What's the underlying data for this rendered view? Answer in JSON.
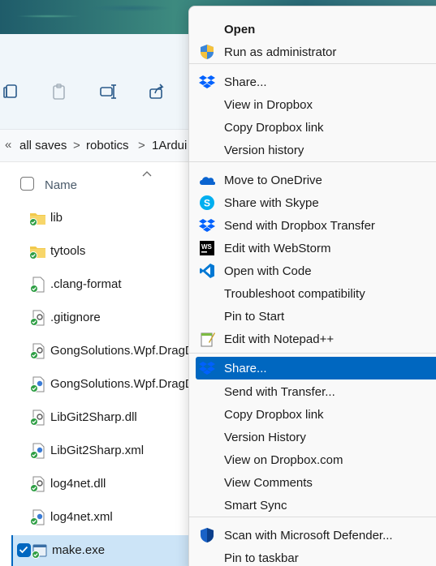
{
  "explorer": {
    "breadcrumb": {
      "chevron": "«",
      "items": [
        "all saves",
        "robotics",
        "1Ardui"
      ],
      "separators": [
        ">",
        ">"
      ]
    },
    "column_name": "Name",
    "files": [
      {
        "name": "lib",
        "icon": "folder-icon"
      },
      {
        "name": "tytools",
        "icon": "folder-icon"
      },
      {
        "name": ".clang-format",
        "icon": "file-icon"
      },
      {
        "name": ".gitignore",
        "icon": "config-file-icon"
      },
      {
        "name": "GongSolutions.Wpf.DragD",
        "icon": "config-file-icon"
      },
      {
        "name": "GongSolutions.Wpf.DragD",
        "icon": "xml-file-icon"
      },
      {
        "name": "LibGit2Sharp.dll",
        "icon": "config-file-icon"
      },
      {
        "name": "LibGit2Sharp.xml",
        "icon": "xml-file-icon"
      },
      {
        "name": "log4net.dll",
        "icon": "config-file-icon"
      },
      {
        "name": "log4net.xml",
        "icon": "xml-file-icon"
      },
      {
        "name": "make.exe",
        "icon": "exe-file-icon"
      }
    ]
  },
  "context_menu": {
    "items": [
      {
        "label": "Open",
        "icon": "",
        "bold": true
      },
      {
        "label": "Run as administrator",
        "icon": "uac-shield-icon"
      },
      {
        "label": "Share...",
        "icon": "dropbox-icon"
      },
      {
        "label": "View in Dropbox",
        "icon": ""
      },
      {
        "label": "Copy Dropbox link",
        "icon": ""
      },
      {
        "label": "Version history",
        "icon": ""
      },
      {
        "label": "Move to OneDrive",
        "icon": "onedrive-icon"
      },
      {
        "label": "Share with Skype",
        "icon": "skype-icon"
      },
      {
        "label": "Send with Dropbox Transfer",
        "icon": "dropbox-icon"
      },
      {
        "label": "Edit with WebStorm",
        "icon": "webstorm-icon"
      },
      {
        "label": "Open with Code",
        "icon": "vscode-icon"
      },
      {
        "label": "Troubleshoot compatibility",
        "icon": ""
      },
      {
        "label": "Pin to Start",
        "icon": ""
      },
      {
        "label": "Edit with Notepad++",
        "icon": "notepadpp-icon"
      },
      {
        "label": "Share...",
        "icon": "dropbox-icon",
        "highlighted": true
      },
      {
        "label": "Send with Transfer...",
        "icon": ""
      },
      {
        "label": "Copy Dropbox link",
        "icon": ""
      },
      {
        "label": "Version History",
        "icon": ""
      },
      {
        "label": "View on Dropbox.com",
        "icon": ""
      },
      {
        "label": "View Comments",
        "icon": ""
      },
      {
        "label": "Smart Sync",
        "icon": ""
      },
      {
        "label": "Scan with Microsoft Defender...",
        "icon": "defender-icon"
      },
      {
        "label": "Pin to taskbar",
        "icon": ""
      }
    ]
  },
  "colors": {
    "accent": "#0067c0",
    "selection": "#cce4f7",
    "dropbox": "#0061fe",
    "folder": "#f2c94c",
    "sync_green": "#2e9e44"
  }
}
